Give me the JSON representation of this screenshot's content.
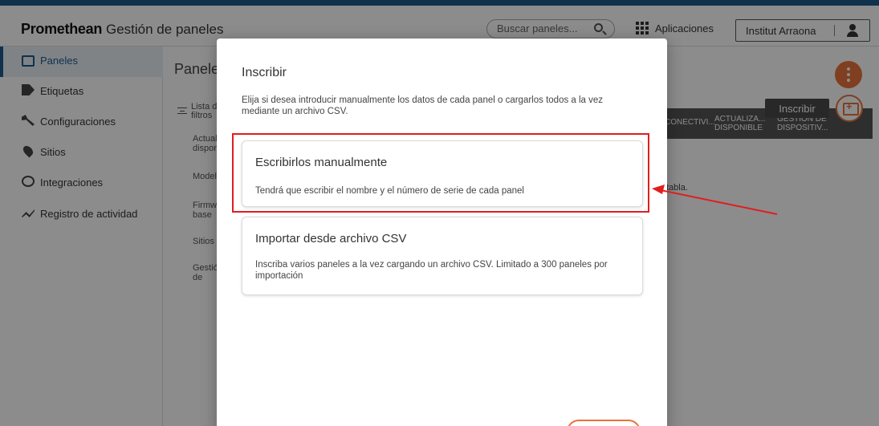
{
  "header": {
    "brand": "Promethean",
    "subtitle": "Gestión de paneles",
    "search_placeholder": "Buscar paneles...",
    "apps_label": "Aplicaciones",
    "account_name": "Institut Arraona"
  },
  "sidebar": {
    "items": [
      {
        "label": "Paneles",
        "icon": "panel-icon"
      },
      {
        "label": "Etiquetas",
        "icon": "tag-icon"
      },
      {
        "label": "Configuraciones",
        "icon": "wrench-icon"
      },
      {
        "label": "Sitios",
        "icon": "location-pin-icon"
      },
      {
        "label": "Integraciones",
        "icon": "integrations-icon"
      },
      {
        "label": "Registro de actividad",
        "icon": "activity-icon"
      }
    ]
  },
  "main": {
    "title": "Paneles",
    "filter_label": "Lista de filtros",
    "filters": [
      "Actualización disponible",
      "Modelo",
      "Firmware base",
      "Sitios",
      "Gestión de dispositivos"
    ],
    "table_headers": [
      "CONECTIVI...",
      "ACTUALIZA... DISPONIBLE",
      "GESTIÓN DE DISPOSITIV..."
    ],
    "table_text": "tabla."
  },
  "tooltip": "Inscribir",
  "modal": {
    "title": "Inscribir",
    "description": "Elija si desea introducir manualmente los datos de cada panel o cargarlos todos a la vez mediante un archivo CSV.",
    "options": [
      {
        "title": "Escribirlos manualmente",
        "description": "Tendrá que escribir el nombre y el número de serie de cada panel"
      },
      {
        "title": "Importar desde archivo CSV",
        "description": "Inscriba varios paneles a la vez cargando un archivo CSV. Limitado a 300 paneles por importación"
      }
    ]
  },
  "colors": {
    "accent": "#e8743b",
    "brand_blue": "#1e5a8a",
    "highlight_red": "#e01e1e"
  }
}
